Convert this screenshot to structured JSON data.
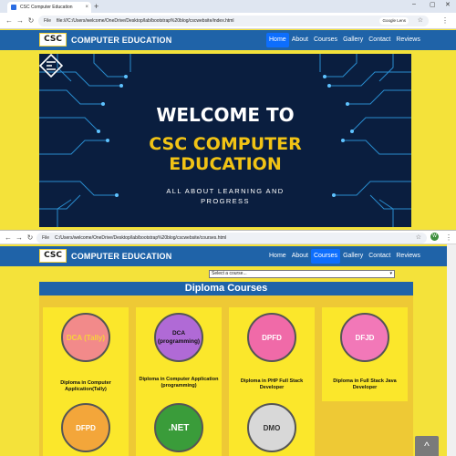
{
  "browser1": {
    "tab_title": "CSC Computer Education",
    "tab_close": "×",
    "new_tab": "+",
    "file_label": "File",
    "url": "file:///C:/Users/welcome/OneDrive/Desktop/lab/bootstrap%20blog/cscwebsite/index.html",
    "lens_label": "Google Lens"
  },
  "browser2": {
    "file_label": "File",
    "url": "C:/Users/welcome/OneDrive/Desktop/lab/bootstrap%20blog/cscwebsite/courses.html",
    "avatar": "W"
  },
  "site": {
    "logo_text": "CSC",
    "brand": "COMPUTER EDUCATION",
    "nav": [
      "Home",
      "About",
      "Courses",
      "Gallery",
      "Contact",
      "Reviews"
    ],
    "page1_active": "Home",
    "page2_active": "Courses"
  },
  "banner": {
    "welcome": "WELCOME TO",
    "line1": "CSC COMPUTER",
    "line2": "EDUCATION",
    "tagline1": "ALL ABOUT LEARNING AND",
    "tagline2": "PROGRESS"
  },
  "courses_page": {
    "select_placeholder": "Select a course...",
    "section_title": "Diploma Courses",
    "scroll_top": "^",
    "cards": [
      {
        "badge": "DCA (Tally)",
        "title": "Diploma in Computer Application(Tally)",
        "color": "#f28a8a"
      },
      {
        "badge": "DCA (programming)",
        "title": "Diploma in Computer Application (programming)",
        "color": "#b06ad6"
      },
      {
        "badge": "DPFD",
        "title": "Diploma in PHP Full Stack Developer",
        "color": "#f06aa8"
      },
      {
        "badge": "DFJD",
        "title": "Diploma in Full Stack Java Developer",
        "color": "#f278b8"
      },
      {
        "badge": "DFPD",
        "title": "",
        "color": "#f3a63a"
      },
      {
        "badge": ".NET",
        "title": "",
        "color": "#3a9c3a"
      },
      {
        "badge": "DMO",
        "title": "",
        "color": "#d8d8d8"
      }
    ]
  }
}
